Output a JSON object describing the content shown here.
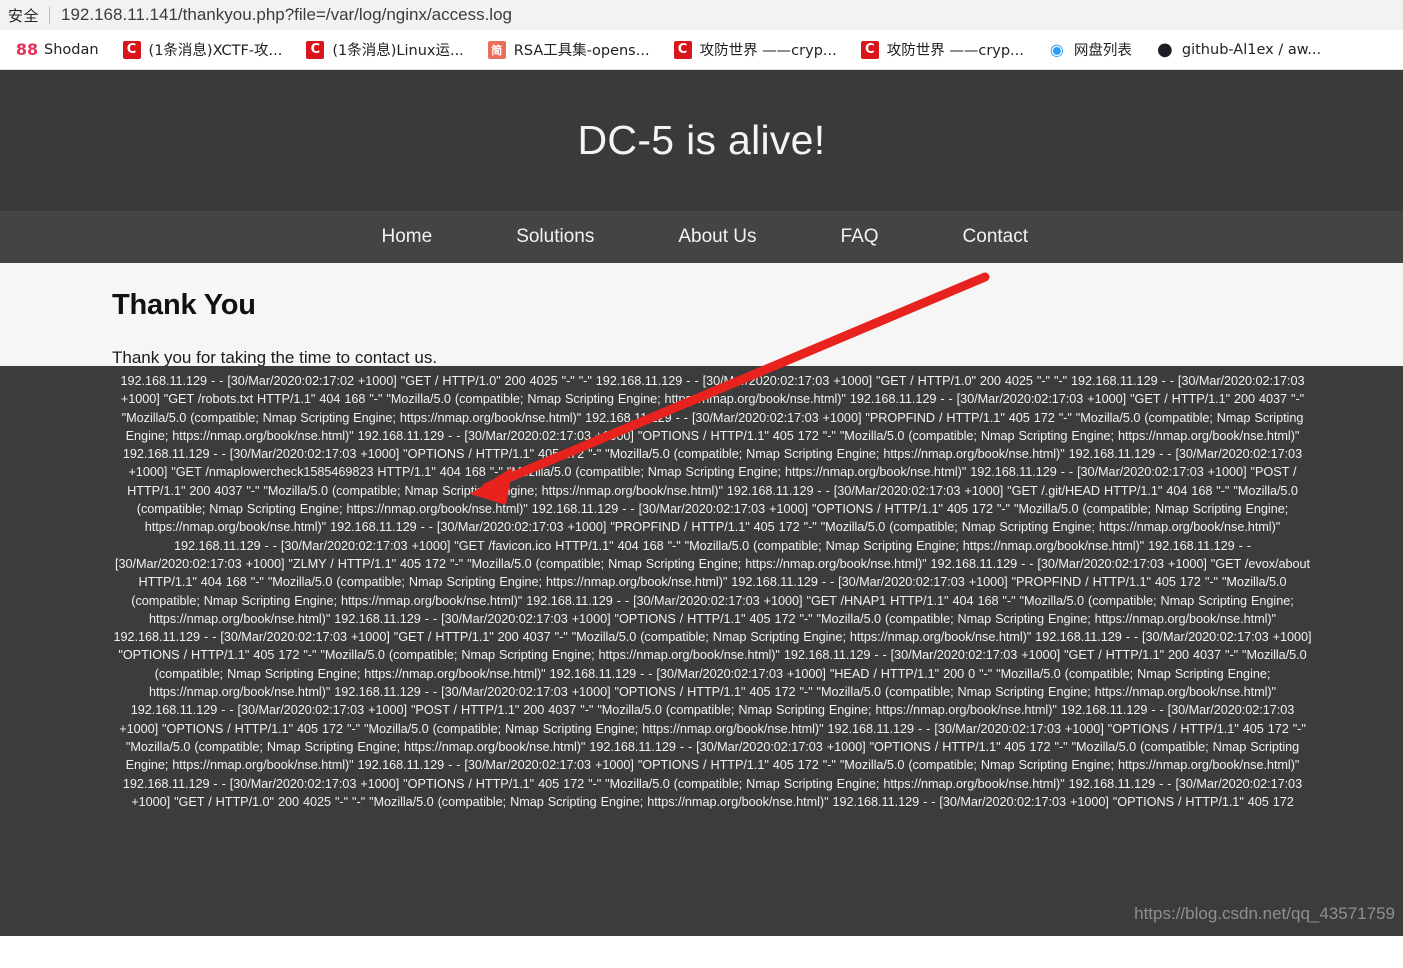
{
  "browser": {
    "security_label": "安全",
    "url": "192.168.11.141/thankyou.php?file=/var/log/nginx/access.log",
    "bookmarks": [
      {
        "icon": "shodan-icon",
        "glyph": "88",
        "label": "Shodan",
        "cls": "ico-shodan"
      },
      {
        "icon": "csdn-icon",
        "glyph": "C",
        "label": "(1条消息)XCTF-攻...",
        "cls": "ico-csdn"
      },
      {
        "icon": "csdn-icon",
        "glyph": "C",
        "label": "(1条消息)Linux运...",
        "cls": "ico-csdn"
      },
      {
        "icon": "jianshu-icon",
        "glyph": "简",
        "label": "RSA工具集-opens...",
        "cls": "ico-jian"
      },
      {
        "icon": "csdn-icon",
        "glyph": "C",
        "label": "攻防世界 ——cryp...",
        "cls": "ico-csdn"
      },
      {
        "icon": "csdn-icon",
        "glyph": "C",
        "label": "攻防世界 ——cryp...",
        "cls": "ico-csdn"
      },
      {
        "icon": "pan-icon",
        "glyph": "◉",
        "label": "网盘列表",
        "cls": "ico-pan"
      },
      {
        "icon": "github-icon",
        "glyph": "●",
        "label": "github-Al1ex / aw...",
        "cls": "ico-github"
      }
    ]
  },
  "page": {
    "hero_title": "DC-5 is alive!",
    "nav": [
      {
        "label": "Home"
      },
      {
        "label": "Solutions"
      },
      {
        "label": "About Us"
      },
      {
        "label": "FAQ"
      },
      {
        "label": "Contact"
      }
    ],
    "heading": "Thank You",
    "body_text": "Thank you for taking the time to contact us.",
    "watermark": "https://blog.csdn.net/qq_43571759",
    "log_text": "192.168.11.129 - - [30/Mar/2020:02:17:02 +1000] \"GET / HTTP/1.0\" 200 4025 \"-\" \"-\" 192.168.11.129 - - [30/Mar/2020:02:17:03 +1000] \"GET / HTTP/1.0\" 200 4025 \"-\" \"-\" 192.168.11.129 - - [30/Mar/2020:02:17:03 +1000] \"GET /robots.txt HTTP/1.1\" 404 168 \"-\" \"Mozilla/5.0 (compatible; Nmap Scripting Engine; https://nmap.org/book/nse.html)\" 192.168.11.129 - - [30/Mar/2020:02:17:03 +1000] \"GET / HTTP/1.1\" 200 4037 \"-\" \"Mozilla/5.0 (compatible; Nmap Scripting Engine; https://nmap.org/book/nse.html)\" 192.168.11.129 - - [30/Mar/2020:02:17:03 +1000] \"PROPFIND / HTTP/1.1\" 405 172 \"-\" \"Mozilla/5.0 (compatible; Nmap Scripting Engine; https://nmap.org/book/nse.html)\" 192.168.11.129 - - [30/Mar/2020:02:17:03 +1000] \"OPTIONS / HTTP/1.1\" 405 172 \"-\" \"Mozilla/5.0 (compatible; Nmap Scripting Engine; https://nmap.org/book/nse.html)\" 192.168.11.129 - - [30/Mar/2020:02:17:03 +1000] \"OPTIONS / HTTP/1.1\" 405 172 \"-\" \"Mozilla/5.0 (compatible; Nmap Scripting Engine; https://nmap.org/book/nse.html)\" 192.168.11.129 - - [30/Mar/2020:02:17:03 +1000] \"GET /nmaplowercheck1585469823 HTTP/1.1\" 404 168 \"-\" \"Mozilla/5.0 (compatible; Nmap Scripting Engine; https://nmap.org/book/nse.html)\" 192.168.11.129 - - [30/Mar/2020:02:17:03 +1000] \"POST / HTTP/1.1\" 200 4037 \"-\" \"Mozilla/5.0 (compatible; Nmap Scripting Engine; https://nmap.org/book/nse.html)\" 192.168.11.129 - - [30/Mar/2020:02:17:03 +1000] \"GET /.git/HEAD HTTP/1.1\" 404 168 \"-\" \"Mozilla/5.0 (compatible; Nmap Scripting Engine; https://nmap.org/book/nse.html)\" 192.168.11.129 - - [30/Mar/2020:02:17:03 +1000] \"OPTIONS / HTTP/1.1\" 405 172 \"-\" \"Mozilla/5.0 (compatible; Nmap Scripting Engine; https://nmap.org/book/nse.html)\" 192.168.11.129 - - [30/Mar/2020:02:17:03 +1000] \"PROPFIND / HTTP/1.1\" 405 172 \"-\" \"Mozilla/5.0 (compatible; Nmap Scripting Engine; https://nmap.org/book/nse.html)\" 192.168.11.129 - - [30/Mar/2020:02:17:03 +1000] \"GET /favicon.ico HTTP/1.1\" 404 168 \"-\" \"Mozilla/5.0 (compatible; Nmap Scripting Engine; https://nmap.org/book/nse.html)\" 192.168.11.129 - - [30/Mar/2020:02:17:03 +1000] \"ZLMY / HTTP/1.1\" 405 172 \"-\" \"Mozilla/5.0 (compatible; Nmap Scripting Engine; https://nmap.org/book/nse.html)\" 192.168.11.129 - - [30/Mar/2020:02:17:03 +1000] \"GET /evox/about HTTP/1.1\" 404 168 \"-\" \"Mozilla/5.0 (compatible; Nmap Scripting Engine; https://nmap.org/book/nse.html)\" 192.168.11.129 - - [30/Mar/2020:02:17:03 +1000] \"PROPFIND / HTTP/1.1\" 405 172 \"-\" \"Mozilla/5.0 (compatible; Nmap Scripting Engine; https://nmap.org/book/nse.html)\" 192.168.11.129 - - [30/Mar/2020:02:17:03 +1000] \"GET /HNAP1 HTTP/1.1\" 404 168 \"-\" \"Mozilla/5.0 (compatible; Nmap Scripting Engine; https://nmap.org/book/nse.html)\" 192.168.11.129 - - [30/Mar/2020:02:17:03 +1000] \"OPTIONS / HTTP/1.1\" 405 172 \"-\" \"Mozilla/5.0 (compatible; Nmap Scripting Engine; https://nmap.org/book/nse.html)\" 192.168.11.129 - - [30/Mar/2020:02:17:03 +1000] \"GET / HTTP/1.1\" 200 4037 \"-\" \"Mozilla/5.0 (compatible; Nmap Scripting Engine; https://nmap.org/book/nse.html)\" 192.168.11.129 - - [30/Mar/2020:02:17:03 +1000] \"OPTIONS / HTTP/1.1\" 405 172 \"-\" \"Mozilla/5.0 (compatible; Nmap Scripting Engine; https://nmap.org/book/nse.html)\" 192.168.11.129 - - [30/Mar/2020:02:17:03 +1000] \"GET / HTTP/1.1\" 200 4037 \"-\" \"Mozilla/5.0 (compatible; Nmap Scripting Engine; https://nmap.org/book/nse.html)\" 192.168.11.129 - - [30/Mar/2020:02:17:03 +1000] \"HEAD / HTTP/1.1\" 200 0 \"-\" \"Mozilla/5.0 (compatible; Nmap Scripting Engine; https://nmap.org/book/nse.html)\" 192.168.11.129 - - [30/Mar/2020:02:17:03 +1000] \"OPTIONS / HTTP/1.1\" 405 172 \"-\" \"Mozilla/5.0 (compatible; Nmap Scripting Engine; https://nmap.org/book/nse.html)\" 192.168.11.129 - - [30/Mar/2020:02:17:03 +1000] \"POST / HTTP/1.1\" 200 4037 \"-\" \"Mozilla/5.0 (compatible; Nmap Scripting Engine; https://nmap.org/book/nse.html)\" 192.168.11.129 - - [30/Mar/2020:02:17:03 +1000] \"OPTIONS / HTTP/1.1\" 405 172 \"-\" \"Mozilla/5.0 (compatible; Nmap Scripting Engine; https://nmap.org/book/nse.html)\" 192.168.11.129 - - [30/Mar/2020:02:17:03 +1000] \"OPTIONS / HTTP/1.1\" 405 172 \"-\" \"Mozilla/5.0 (compatible; Nmap Scripting Engine; https://nmap.org/book/nse.html)\" 192.168.11.129 - - [30/Mar/2020:02:17:03 +1000] \"OPTIONS / HTTP/1.1\" 405 172 \"-\" \"Mozilla/5.0 (compatible; Nmap Scripting Engine; https://nmap.org/book/nse.html)\" 192.168.11.129 - - [30/Mar/2020:02:17:03 +1000] \"OPTIONS / HTTP/1.1\" 405 172 \"-\" \"Mozilla/5.0 (compatible; Nmap Scripting Engine; https://nmap.org/book/nse.html)\" 192.168.11.129 - - [30/Mar/2020:02:17:03 +1000] \"OPTIONS / HTTP/1.1\" 405 172 \"-\" \"Mozilla/5.0 (compatible; Nmap Scripting Engine; https://nmap.org/book/nse.html)\" 192.168.11.129 - - [30/Mar/2020:02:17:03 +1000] \"GET / HTTP/1.0\" 200 4025 \"-\" \"-\" \"Mozilla/5.0 (compatible; Nmap Scripting Engine; https://nmap.org/book/nse.html)\" 192.168.11.129 - - [30/Mar/2020:02:17:03 +1000] \"OPTIONS / HTTP/1.1\" 405 172"
  },
  "annotation": {
    "arrow_color": "#e8231e"
  }
}
